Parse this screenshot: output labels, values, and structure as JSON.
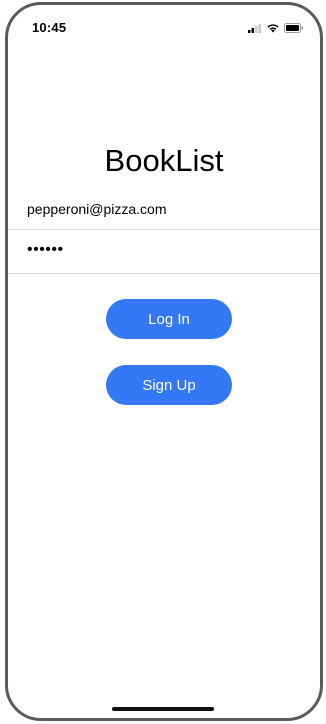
{
  "status_bar": {
    "time": "10:45"
  },
  "app": {
    "title": "BookList"
  },
  "form": {
    "email_value": "pepperoni@pizza.com",
    "password_masked": "••••••"
  },
  "buttons": {
    "login_label": "Log In",
    "signup_label": "Sign Up"
  },
  "colors": {
    "accent": "#3478f6",
    "separator": "#dcdcdc",
    "frame": "#5b5b5b"
  },
  "icons": [
    "cellular-signal-icon",
    "wifi-icon",
    "battery-icon"
  ]
}
